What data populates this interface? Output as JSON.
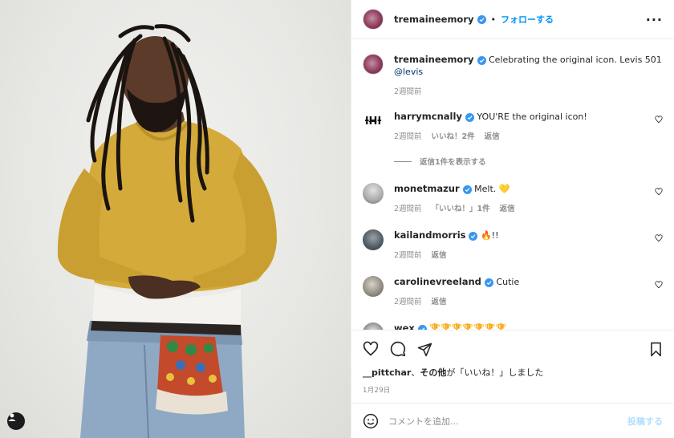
{
  "post_author": {
    "username": "tremaineemory",
    "verified": true,
    "separator": "•",
    "follow_label": "フォローする",
    "more_icon": "more-horizontal-icon"
  },
  "caption": {
    "username": "tremaineemory",
    "text": "Celebrating the original icon. Levis 501 ",
    "mention": "@levis",
    "time": "2週間前"
  },
  "comments": [
    {
      "username": "harrymcnally",
      "text": "YOU'RE the original icon!",
      "time": "2週間前",
      "likes": "いいね！2件",
      "reply": "返信",
      "view_replies": "返信1件を表示する",
      "avatar_text": "ƚH̶ƚ"
    },
    {
      "username": "monetmazur",
      "text": "Melt. 💛",
      "time": "2週間前",
      "likes": "「いいね！」1件",
      "reply": "返信"
    },
    {
      "username": "kailandmorris",
      "text": "🔥!!",
      "time": "2週間前",
      "likes": "",
      "reply": "返信"
    },
    {
      "username": "carolinevreeland",
      "text": "Cutie",
      "time": "2週間前",
      "likes": "",
      "reply": "返信"
    },
    {
      "username": "wex",
      "text": "🏆🏆🏆🏆🏆🏆🏆",
      "time": "",
      "likes": "",
      "reply": ""
    }
  ],
  "liked_by": {
    "user": "__pittchar",
    "connector": "、",
    "others": "その他",
    "suffix": "が「いいね！」しました"
  },
  "post_date": "1月29日",
  "add_comment": {
    "placeholder": "コメントを追加...",
    "post_label": "投稿する"
  },
  "colors": {
    "accent": "#0095f6",
    "verified": "#3897f0",
    "muted": "#8e8e8e",
    "post_disabled": "#b2dffc"
  }
}
